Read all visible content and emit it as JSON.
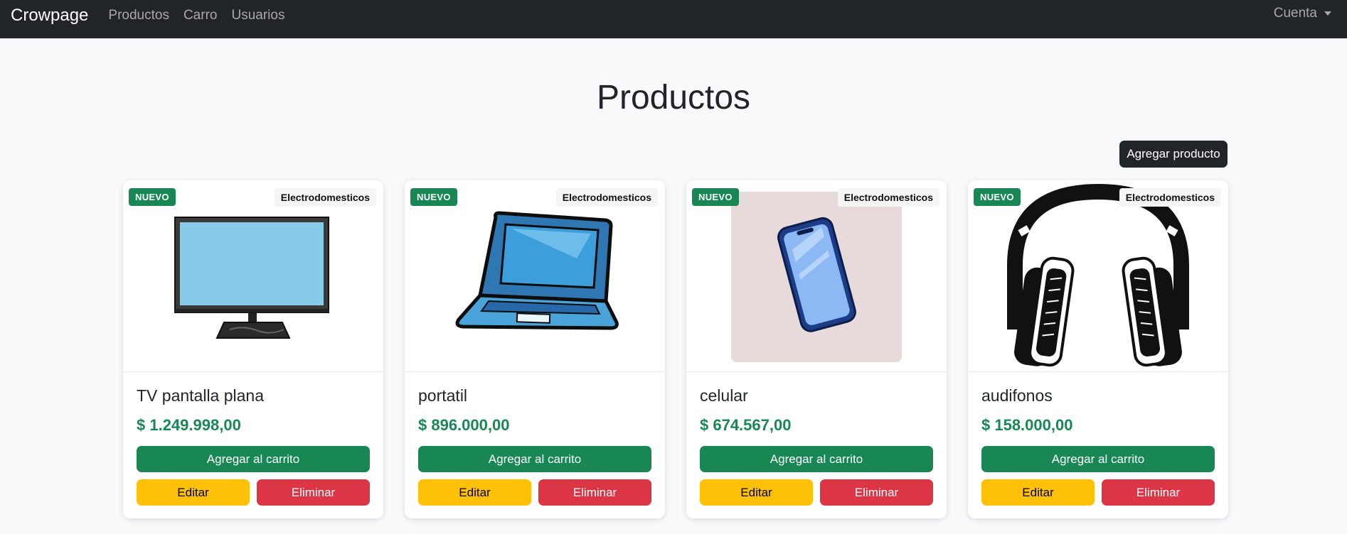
{
  "navbar": {
    "brand": "Crowpage",
    "links": [
      "Productos",
      "Carro",
      "Usuarios"
    ],
    "account": "Cuenta"
  },
  "page": {
    "title": "Productos",
    "add_button": "Agregar producto"
  },
  "products": [
    {
      "name": "TV pantalla plana",
      "price": "$ 1.249.998,00",
      "badge": "NUEVO",
      "category": "Electrodomesticos",
      "image": "tv-icon"
    },
    {
      "name": "portatil",
      "price": "$ 896.000,00",
      "badge": "NUEVO",
      "category": "Electrodomesticos",
      "image": "laptop-icon"
    },
    {
      "name": "celular",
      "price": "$ 674.567,00",
      "badge": "NUEVO",
      "category": "Electrodomesticos",
      "image": "phone-icon"
    },
    {
      "name": "audifonos",
      "price": "$ 158.000,00",
      "badge": "NUEVO",
      "category": "Electrodomesticos",
      "image": "headphones-icon"
    }
  ],
  "card_buttons": {
    "cart": "Agregar al carrito",
    "edit": "Editar",
    "delete": "Eliminar"
  },
  "colors": {
    "navbar": "#212529",
    "success": "#198754",
    "warning": "#ffc107",
    "danger": "#dc3545"
  }
}
